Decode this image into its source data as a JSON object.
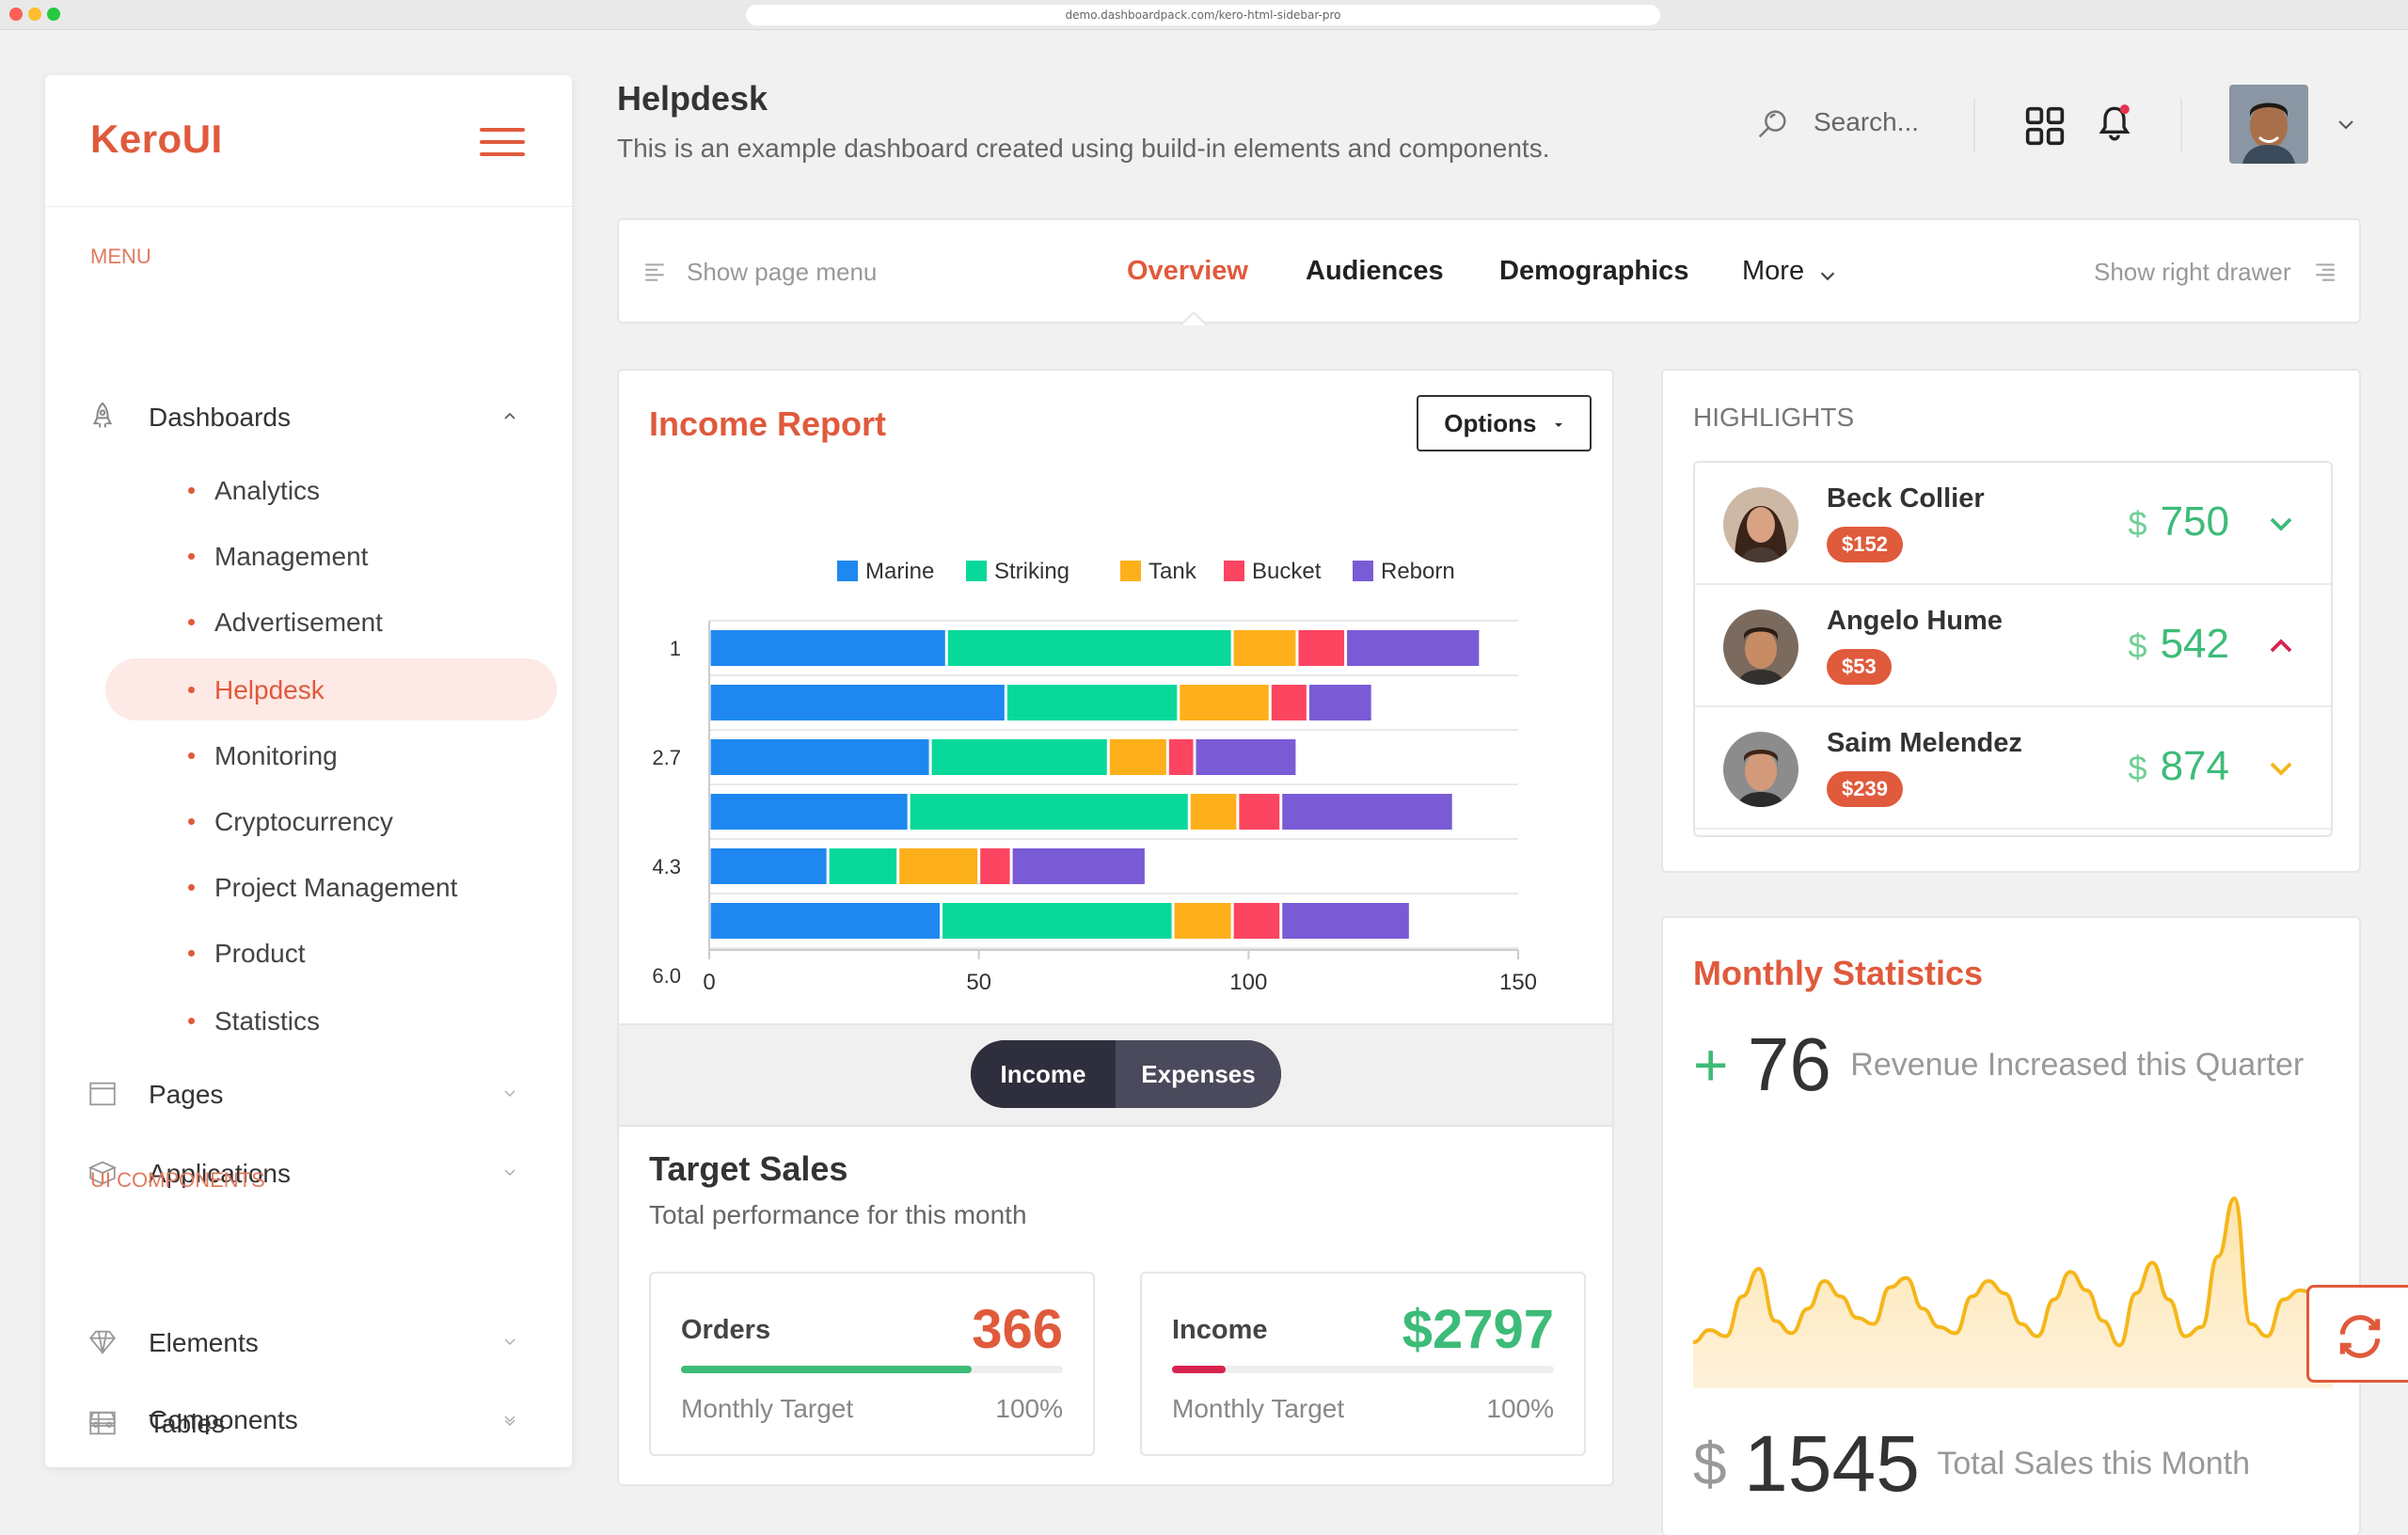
{
  "browser": {
    "url": "demo.dashboardpack.com/kero-html-sidebar-pro"
  },
  "sidebar": {
    "logo": "KeroUI",
    "menu_label": "MENU",
    "dashboards_label": "Dashboards",
    "dashboard_items": [
      {
        "label": "Analytics"
      },
      {
        "label": "Management"
      },
      {
        "label": "Advertisement"
      },
      {
        "label": "Helpdesk",
        "active": true
      },
      {
        "label": "Monitoring"
      },
      {
        "label": "Cryptocurrency"
      },
      {
        "label": "Project Management"
      },
      {
        "label": "Product"
      },
      {
        "label": "Statistics"
      }
    ],
    "pages_label": "Pages",
    "applications_label": "Applications",
    "ui_components_label": "UI COMPONENTS",
    "elements_label": "Elements",
    "components_label": "Components",
    "tables_label": "Tables"
  },
  "header": {
    "title": "Helpdesk",
    "subtitle": "This is an example dashboard created using build-in elements and components.",
    "search_placeholder": "Search...",
    "notification_dot_color": "#e5334e"
  },
  "tabs": {
    "show_page_menu": "Show page menu",
    "items": [
      {
        "label": "Overview",
        "active": true
      },
      {
        "label": "Audiences"
      },
      {
        "label": "Demographics"
      },
      {
        "label": "More"
      }
    ],
    "show_right_drawer": "Show right drawer"
  },
  "income_report": {
    "title": "Income Report",
    "options_label": "Options",
    "toggle": {
      "income": "Income",
      "expenses": "Expenses",
      "selected": "income"
    }
  },
  "chart_data": {
    "type": "bar",
    "orientation": "horizontal",
    "stacked": true,
    "y_tick_labels": [
      "1",
      "2.7",
      "4.3",
      "6.0"
    ],
    "x_ticks": [
      0,
      50,
      100,
      150
    ],
    "xlim": [
      0,
      150
    ],
    "legend_position": "top",
    "series": [
      {
        "name": "Marine",
        "color": "#1e88f0",
        "values": [
          44,
          55,
          41,
          37,
          22,
          43
        ]
      },
      {
        "name": "Striking",
        "color": "#08d99a",
        "values": [
          53,
          32,
          33,
          52,
          13,
          43
        ]
      },
      {
        "name": "Tank",
        "color": "#fdb01a",
        "values": [
          12,
          17,
          11,
          9,
          15,
          11
        ]
      },
      {
        "name": "Bucket",
        "color": "#fc4560",
        "values": [
          9,
          7,
          5,
          8,
          6,
          9
        ]
      },
      {
        "name": "Reborn",
        "color": "#7a5bd6",
        "values": [
          25,
          12,
          19,
          32,
          25,
          24
        ]
      }
    ]
  },
  "target_sales": {
    "title": "Target Sales",
    "subtitle": "Total performance for this month",
    "orders": {
      "label": "Orders",
      "value": "366",
      "foot": "Monthly Target",
      "pct": "100%",
      "progress": 0.76,
      "color": "#e05a3c",
      "bar_color": "#3dbb78"
    },
    "income": {
      "label": "Income",
      "value": "$2797",
      "foot": "Monthly Target",
      "pct": "100%",
      "progress": 0.14,
      "color": "#3dbb78",
      "bar_color": "#d6234e"
    }
  },
  "highlights": {
    "label": "HIGHLIGHTS",
    "items": [
      {
        "name": "Beck Collier",
        "badge": "$152",
        "currency": "$",
        "amount": "750",
        "trend": "down",
        "chev_color": "#3dbb78"
      },
      {
        "name": "Angelo Hume",
        "badge": "$53",
        "currency": "$",
        "amount": "542",
        "trend": "up",
        "chev_color": "#d6234e"
      },
      {
        "name": "Saim Melendez",
        "badge": "$239",
        "currency": "$",
        "amount": "874",
        "trend": "down",
        "chev_color": "#f5b619"
      }
    ]
  },
  "monthly_stats": {
    "title": "Monthly Statistics",
    "plus": "+",
    "value": "76",
    "caption": "Revenue Increased this Quarter",
    "currency": "$",
    "total": "1545",
    "total_caption": "Total Sales this Month",
    "sparkline": [
      30,
      38,
      34,
      60,
      78,
      44,
      36,
      52,
      70,
      60,
      46,
      42,
      66,
      72,
      52,
      40,
      36,
      60,
      70,
      62,
      42,
      34,
      58,
      76,
      64,
      44,
      28,
      62,
      82,
      58,
      34,
      40,
      86,
      124,
      42,
      34,
      58,
      64,
      62,
      60
    ]
  },
  "colors": {
    "accent": "#e05a3c",
    "green": "#3dbb78",
    "dark": "#2e2e3c"
  }
}
